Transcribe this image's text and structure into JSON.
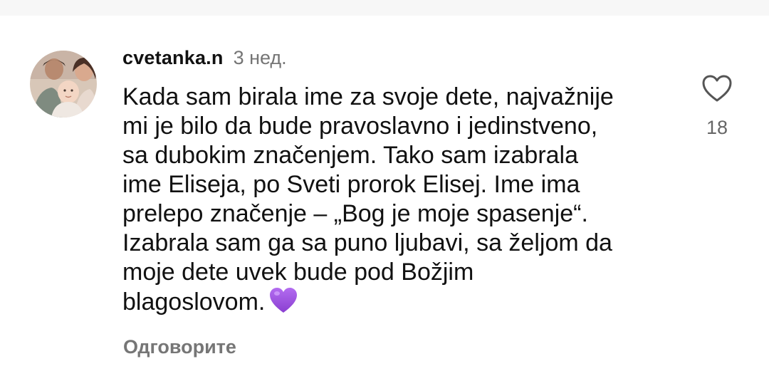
{
  "comment": {
    "username": "cvetanka.n",
    "time": "3 нед.",
    "text": "Kada sam birala ime za svoje dete, najvažnije\nmi je bilo da bude pravoslavno i jedinstveno,\nsa dubokim značenjem. Tako sam izabrala\nime Eliseja, po Sveti prorok Elisej. Ime ima\nprelepo značenje – „Bog je moje spasenje“.\nIzabrala sam ga sa puno ljubavi, sa željom da\nmoje dete uvek bude pod Božjim\nblagoslovom.",
    "emoji": "purple-heart-icon",
    "reply_label": "Одговорите",
    "likes": "18"
  },
  "icons": {
    "like": "heart-outline-icon"
  },
  "colors": {
    "text": "#111111",
    "muted": "#757575",
    "emoji_heart": "#9b4dde"
  }
}
